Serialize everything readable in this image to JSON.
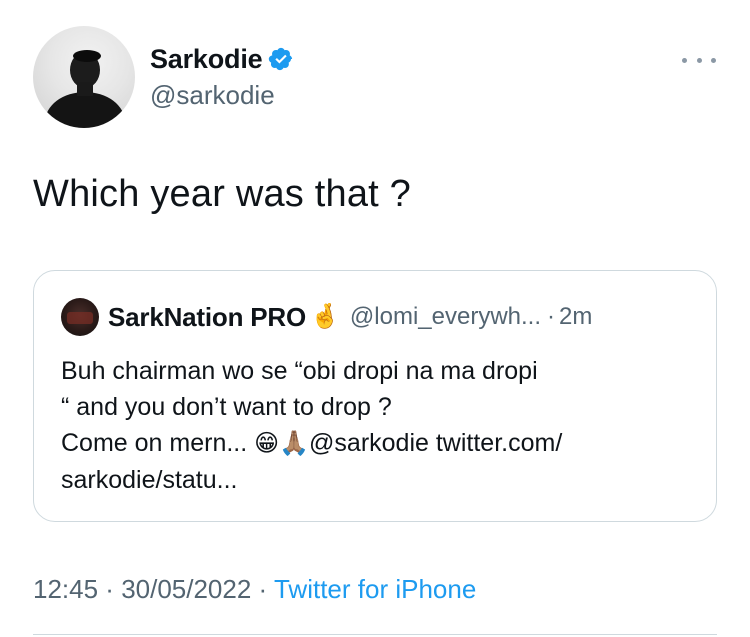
{
  "author": {
    "name": "Sarkodie",
    "handle": "@sarkodie",
    "verified": true,
    "verified_color": "#1d9bf0"
  },
  "tweet": {
    "text": "Which year was that ?"
  },
  "quoted_tweet": {
    "name": "SarkNation PRO",
    "name_emoji": "🤞",
    "handle": "@lomi_everywh...",
    "separator": "·",
    "time": "2m",
    "body_lines": [
      "Buh chairman wo se “obi dropi na ma dropi",
      "“ and you don’t want to drop ?"
    ],
    "line3_text": "Come on mern... ",
    "line3_emojis": "😁🙏🏽",
    "line3_mention": "@sarkodie twitter.com/",
    "line4_text": "sarkodie/statu..."
  },
  "meta": {
    "time": "12:45",
    "sep1": " · ",
    "date": "30/05/2022",
    "sep2": " · ",
    "source": "Twitter for iPhone"
  },
  "icons": {
    "more": "more-horizontal-icon",
    "verified": "verified-badge-icon"
  },
  "colors": {
    "text_primary": "#0f1419",
    "text_secondary": "#536471",
    "link": "#1d9bf0",
    "border": "#cfd9de"
  }
}
